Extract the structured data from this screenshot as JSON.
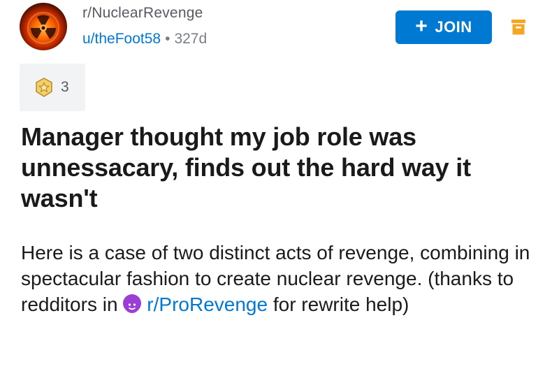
{
  "header": {
    "subreddit": "r/NuclearRevenge",
    "username": "u/theFoot58",
    "separator": "•",
    "age": "327d",
    "join_label": "JOIN",
    "join_icon": "plus-icon",
    "avatar_icon": "radiation-explosion-icon",
    "archive_icon": "archive-icon"
  },
  "awards": {
    "icon": "award-star-icon",
    "count": "3"
  },
  "post": {
    "title": "Manager thought my job role was unnessacary, finds out the hard way it wasn't",
    "body_part1": "Here is a case of two distinct acts of revenge, combining in spectacular fashion to create nuclear revenge. (thanks to redditors in ",
    "link_subreddit": "r/ProRevenge",
    "body_part2": " for rewrite help)",
    "link_icon": "devil-face-icon"
  },
  "colors": {
    "brand_blue": "#0079d3",
    "archive_orange": "#f5a623",
    "award_gold": "#e8b531",
    "devil_purple": "#9b3fd4"
  }
}
